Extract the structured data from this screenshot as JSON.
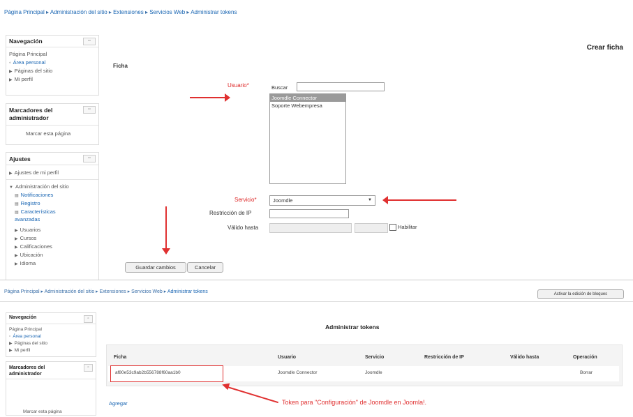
{
  "top": {
    "breadcrumb": [
      "Página Principal",
      "Administración del sitio",
      "Extensiones",
      "Servicios Web",
      "Administrar tokens"
    ],
    "heading": "Crear ficha"
  },
  "nav_block": {
    "title": "Navegación",
    "items": [
      "Página Principal",
      "Área personal",
      "Páginas del sitio",
      "Mi perfil"
    ]
  },
  "bookmarks_block": {
    "title": "Marcadores del administrador",
    "link": "Marcar esta página"
  },
  "settings_block": {
    "title": "Ajustes",
    "items": [
      "Ajustes de mi perfil",
      "Administración del sitio",
      "Notificaciones",
      "Registro",
      "Características avanzadas",
      "Usuarios",
      "Cursos",
      "Calificaciones",
      "Ubicación",
      "Idioma"
    ]
  },
  "form": {
    "legend": "Ficha",
    "user_label": "Usuario",
    "search_label": "Buscar",
    "search_value": "",
    "users": [
      "Joomdle Connector",
      "Soporte Webempresa"
    ],
    "service_label": "Servicio",
    "service_value": "Joomdle",
    "ip_label": "Restricción de IP",
    "ip_value": "",
    "valid_label": "Válido hasta",
    "enable_label": "Habilitar",
    "save_button": "Guardar cambios",
    "cancel_button": "Cancelar",
    "required_mark": "*"
  },
  "bottom": {
    "breadcrumb": [
      "Página Principal",
      "Administración del sitio",
      "Extensiones",
      "Servicios Web",
      "Administrar tokens"
    ],
    "edit_button": "Activar la edición de bloques",
    "nav_title": "Navegación",
    "nav_items": [
      "Página Principal",
      "Área personal",
      "Páginas del sitio",
      "Mi perfil"
    ],
    "bookmarks_title": "Marcadores del administrador",
    "bookmarks_link": "Marcar esta página",
    "manage_title": "Administrar tokens",
    "table_headers": [
      "Ficha",
      "Usuario",
      "Servicio",
      "Restricción de IP",
      "Válido hasta",
      "Operación"
    ],
    "row": {
      "token": "af80e53c9ab2b556788f60aa1b0",
      "user": "Joomdle Connector",
      "service": "Joomdle",
      "ip": "",
      "valid": "",
      "op": "Borrar"
    },
    "add_link": "Agregar",
    "annotation": "Token para \"Configuración\" de Joomdle en Joomla!."
  },
  "colors": {
    "accent_red": "#e03030",
    "link_blue": "#1a66b3"
  }
}
